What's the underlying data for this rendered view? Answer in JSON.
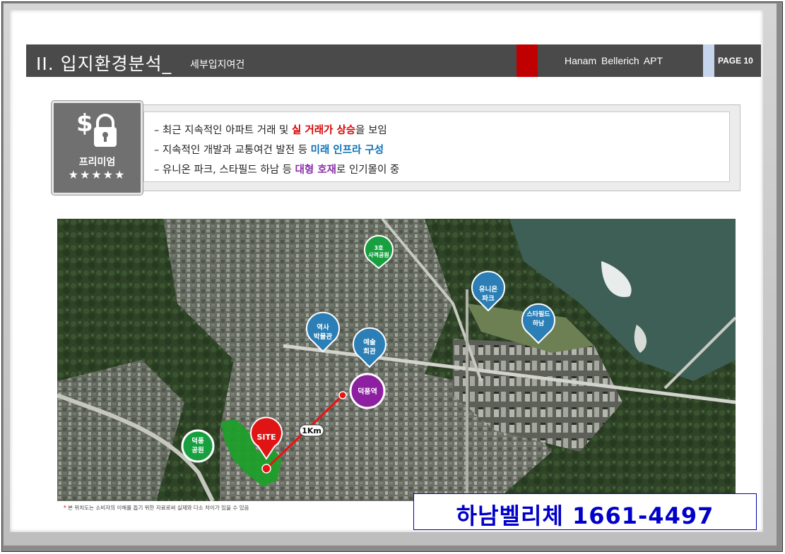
{
  "header": {
    "title": "II. 입지환경분석_",
    "subtitle": "세부입지여건",
    "project": "Hanam  Bellerich  APT",
    "page": "PAGE 10",
    "colors": {
      "bar": "#4a4a4a",
      "accent_red": "#c00000",
      "accent_blue": "#c6d4ec"
    }
  },
  "premium_badge": {
    "label": "프리미엄",
    "stars": "★★★★★",
    "icon": "money-lock-icon"
  },
  "points": [
    {
      "prefix": "– 최근 지속적인 아파트 거래 및 ",
      "highlight": "실 거래가 상승",
      "suffix": "을 보임",
      "color": "#d40000"
    },
    {
      "prefix": "– 지속적인 개발과 교통여건 발전 등 ",
      "highlight": "미래 인프라 구성",
      "suffix": "",
      "color": "#0a6fb4"
    },
    {
      "prefix": "– 유니온 파크, 스타필드 하남 등 ",
      "highlight": "대형 호재",
      "suffix": "로 인기몰이 중",
      "color": "#8a2da8"
    }
  ],
  "map": {
    "site": "SITE",
    "distance": "1Km",
    "pins": {
      "park3": [
        "3호",
        "사격공원"
      ],
      "union": [
        "유니온",
        "파크"
      ],
      "starfield": [
        "스타필드",
        "하남"
      ],
      "museum": [
        "역사",
        "박물관"
      ],
      "arts": [
        "예술",
        "회관"
      ],
      "station": [
        "덕풍역"
      ],
      "deokpung_park": [
        "덕풍",
        "공원"
      ]
    }
  },
  "disclaimer": "본 위치도는 소비자의 이해를 돕기 위한 자료로써 실제와 다소 차이가 있을 수 있음",
  "contact": "하남벨리체 1661-4497"
}
